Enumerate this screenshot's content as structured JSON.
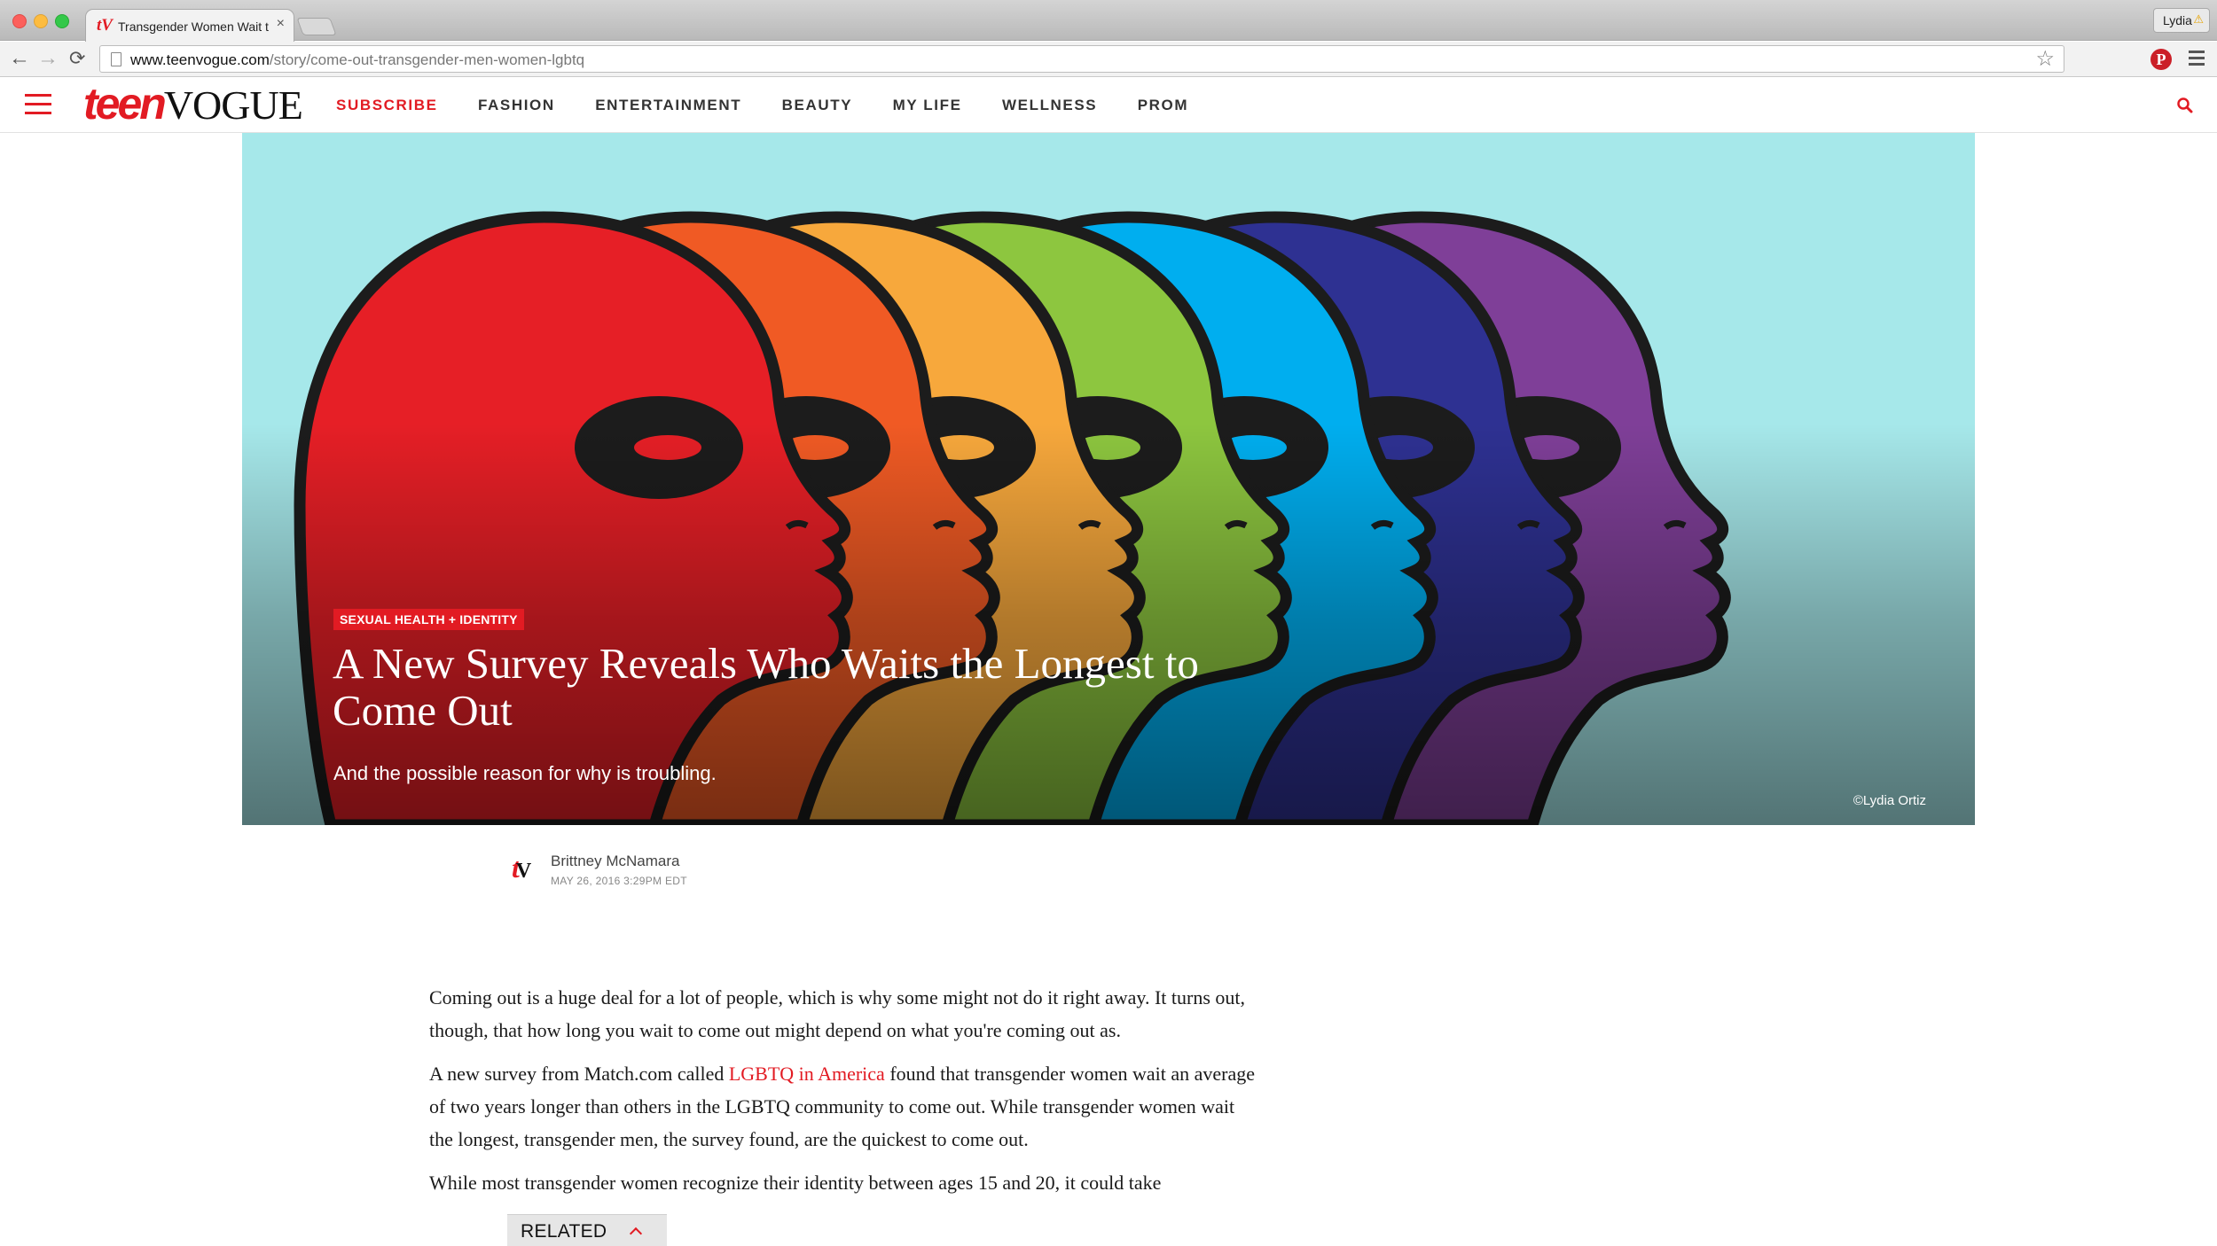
{
  "browser": {
    "tab_title": "Transgender Women Wait the Longest",
    "tab_close": "×",
    "profile_name": "Lydia",
    "url_host": "www.teenvogue.com",
    "url_path": "/story/come-out-transgender-men-women-lgbtq",
    "back": "←",
    "forward": "→",
    "reload": "⟳",
    "star": "☆",
    "pinterest": "P"
  },
  "site": {
    "logo_teen": "teen",
    "logo_vogue": "VOGUE",
    "nav": [
      "SUBSCRIBE",
      "FASHION",
      "ENTERTAINMENT",
      "BEAUTY",
      "MY LIFE",
      "WELLNESS",
      "PROM"
    ],
    "accent_color": "#e21b23"
  },
  "hero": {
    "category": "SEXUAL HEALTH + IDENTITY",
    "title": "A New Survey Reveals Who Waits the Longest to Come Out",
    "dek": "And the possible reason for why is troubling.",
    "credit": "©Lydia Ortiz",
    "background_color": "#a6e8ea",
    "head_colors": [
      "#e61f26",
      "#f05a24",
      "#f7a83c",
      "#8dc63f",
      "#00aeef",
      "#2e3192",
      "#7f3f98"
    ]
  },
  "byline": {
    "logo": "tV",
    "author": "Brittney McNamara",
    "date": "MAY 26, 2016 3:29PM EDT"
  },
  "article": {
    "p1": "Coming out is a huge deal for a lot of people, which is why some might not do it right away. It turns out, though, that how long you wait to come out might depend on what you're coming out as.",
    "p2_before": "A new survey from Match.com called ",
    "p2_link": "LGBTQ in America",
    "p2_after": " found that transgender women wait an average of two years longer than others in the LGBTQ community to come out. While transgender women wait the longest, transgender men, the survey found, are the quickest to come out.",
    "p3": "While most transgender women recognize their identity between ages 15 and 20, it could take"
  },
  "related": {
    "label": "RELATED"
  }
}
